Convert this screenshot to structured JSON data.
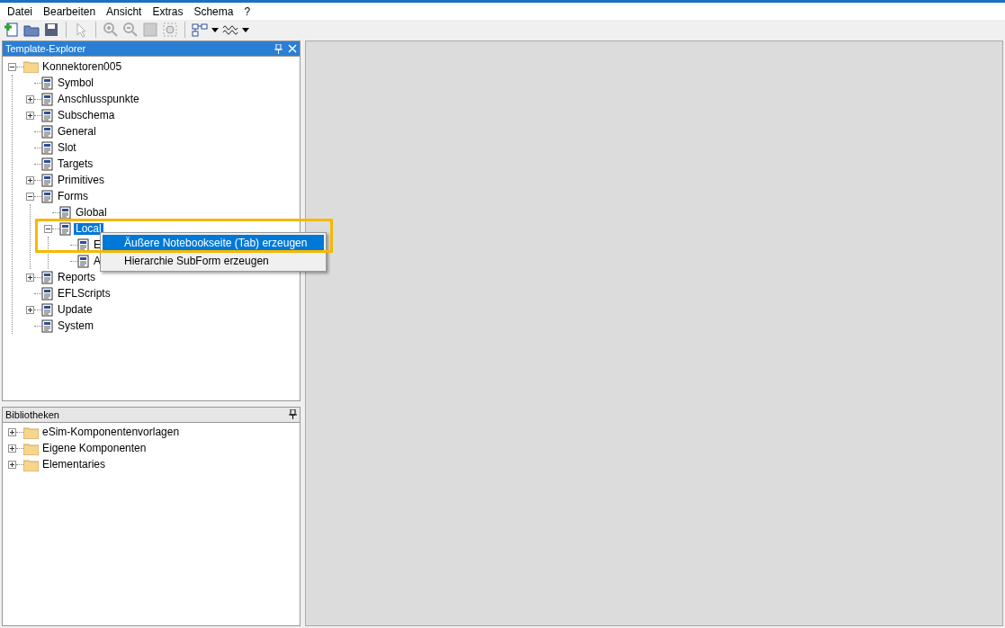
{
  "menu_bar": [
    "Datei",
    "Bearbeiten",
    "Ansicht",
    "Extras",
    "Schema",
    "?"
  ],
  "template_explorer": {
    "title": "Template-Explorer",
    "tree": [
      {
        "label": "Konnektoren005",
        "expanded": true,
        "selected": false,
        "children": [
          {
            "label": "Symbol",
            "selected": false
          },
          {
            "label": "Anschlusspunkte",
            "expanded": false,
            "selected": false
          },
          {
            "label": "Subschema",
            "expanded": false,
            "selected": false
          },
          {
            "label": "General",
            "selected": false
          },
          {
            "label": "Slot",
            "selected": false
          },
          {
            "label": "Targets",
            "selected": false
          },
          {
            "label": "Primitives",
            "expanded": false,
            "selected": false
          },
          {
            "label": "Forms",
            "expanded": true,
            "selected": false,
            "children": [
              {
                "label": "Global",
                "selected": false
              },
              {
                "label": "Local",
                "expanded": true,
                "selected": true,
                "children": [
                  {
                    "label": "E",
                    "selected": false
                  },
                  {
                    "label": "A",
                    "selected": false
                  }
                ]
              }
            ]
          },
          {
            "label": "Reports",
            "expanded": false,
            "selected": false
          },
          {
            "label": "EFLScripts",
            "selected": false
          },
          {
            "label": "Update",
            "expanded": false,
            "selected": false
          },
          {
            "label": "System",
            "selected": false
          }
        ]
      }
    ]
  },
  "context_menu": [
    {
      "label": "Äußere Notebookseite (Tab) erzeugen",
      "selected": true
    },
    {
      "label": "Hierarchie SubForm erzeugen",
      "selected": false
    }
  ],
  "libraries": {
    "title": "Bibliotheken",
    "tree": [
      {
        "label": "eSim-Komponentenvorlagen",
        "expanded": false,
        "selected": false
      },
      {
        "label": "Eigene Komponenten",
        "expanded": false,
        "selected": false
      },
      {
        "label": "Elementaries",
        "expanded": false,
        "selected": false
      }
    ]
  }
}
